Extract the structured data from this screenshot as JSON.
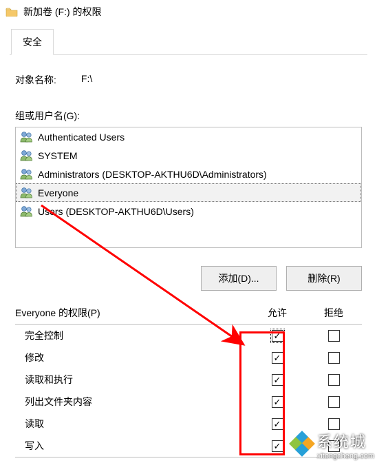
{
  "titlebar": {
    "text": "新加卷 (F:) 的权限"
  },
  "tab": {
    "security": "安全"
  },
  "object": {
    "label": "对象名称:",
    "value": "F:\\"
  },
  "groups": {
    "label": "组或用户名(G):",
    "items": [
      {
        "name": "Authenticated Users",
        "selected": false
      },
      {
        "name": "SYSTEM",
        "selected": false
      },
      {
        "name": "Administrators (DESKTOP-AKTHU6D\\Administrators)",
        "selected": false
      },
      {
        "name": "Everyone",
        "selected": true
      },
      {
        "name": "Users (DESKTOP-AKTHU6D\\Users)",
        "selected": false
      }
    ]
  },
  "buttons": {
    "add": "添加(D)...",
    "remove": "删除(R)"
  },
  "permissions": {
    "label": "Everyone 的权限(P)",
    "col_allow": "允许",
    "col_deny": "拒绝",
    "rows": [
      {
        "name": "完全控制",
        "allow": true,
        "deny": false,
        "focus": true
      },
      {
        "name": "修改",
        "allow": true,
        "deny": false
      },
      {
        "name": "读取和执行",
        "allow": true,
        "deny": false
      },
      {
        "name": "列出文件夹内容",
        "allow": true,
        "deny": false
      },
      {
        "name": "读取",
        "allow": true,
        "deny": false
      },
      {
        "name": "写入",
        "allow": true,
        "deny": false
      }
    ]
  },
  "watermark": {
    "brand": "系统城",
    "url": "xitongcheng.com"
  },
  "annotation": {
    "highlight_column": "allow"
  }
}
